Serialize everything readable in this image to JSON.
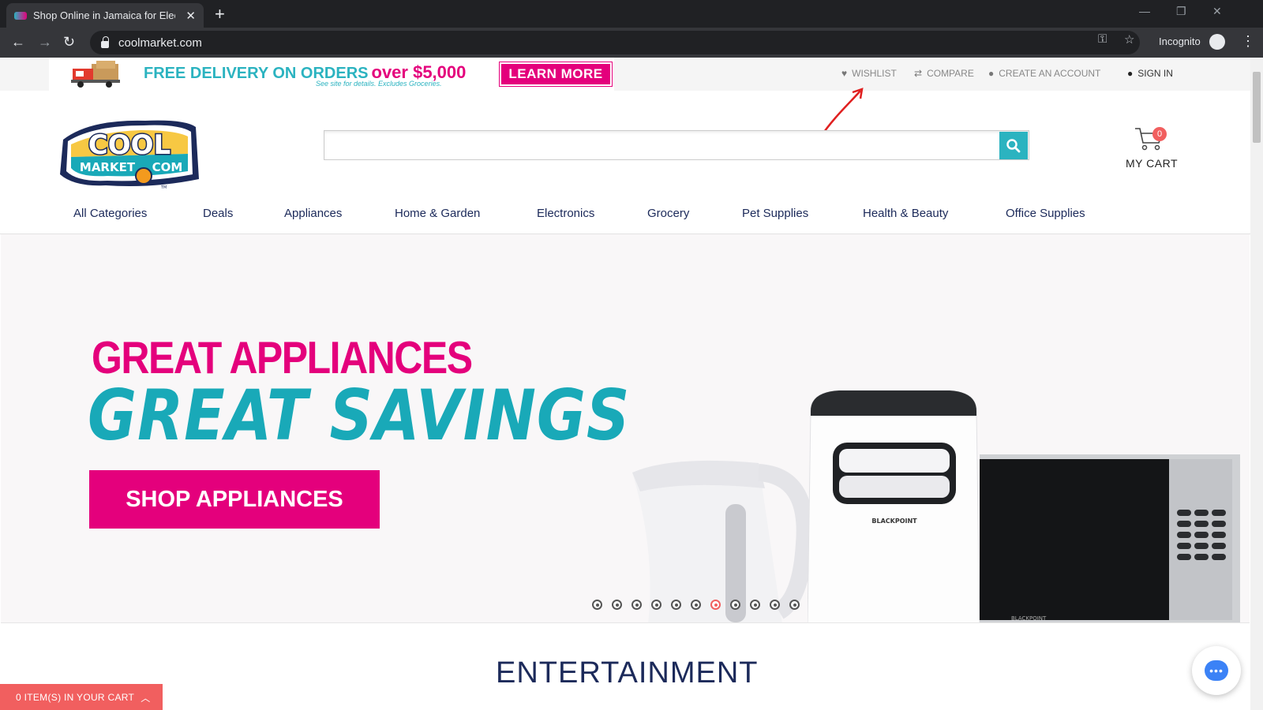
{
  "browser": {
    "tab_title": "Shop Online in Jamaica for Electr",
    "tab_close": "✕",
    "new_tab": "+",
    "url": "coolmarket.com",
    "incognito_label": "Incognito",
    "window_controls": [
      "—",
      "❐",
      "✕"
    ]
  },
  "promo": {
    "headline": "FREE DELIVERY ON ORDERS",
    "amount": "over $5,000",
    "subtext": "See site for details. Excludes Groceries.",
    "button": "LEARN MORE"
  },
  "top_links": {
    "wishlist": "WISHLIST",
    "compare": "COMPARE",
    "create_account": "CREATE AN ACCOUNT",
    "sign_in": "SIGN IN"
  },
  "logo": {
    "line1": "COOL",
    "line2": "MARKET",
    "line3": "COM",
    "tm": "TM"
  },
  "search": {
    "value": "",
    "placeholder": ""
  },
  "cart": {
    "count": "0",
    "label": "MY CART"
  },
  "categories": [
    "All Categories",
    "Deals",
    "Appliances",
    "Home & Garden",
    "Electronics",
    "Grocery",
    "Pet Supplies",
    "Health & Beauty",
    "Office Supplies"
  ],
  "hero": {
    "line1": "GREAT APPLIANCES",
    "line2": "GREAT SAVINGS",
    "button": "SHOP APPLIANCES",
    "brand": "BLACKPOINT",
    "brand2": "BLACKPOINT",
    "slide_count": 11,
    "active_slide": 7
  },
  "section_title": "ENTERTAINMENT",
  "cart_bar": {
    "label": "0 ITEM(S) IN YOUR CART"
  },
  "colors": {
    "brand_pink": "#e4007c",
    "brand_teal": "#2bb3c0",
    "cart_red": "#f15f5f",
    "nav_text": "#1c2a5a"
  },
  "icons": [
    "back-icon",
    "forward-icon",
    "reload-icon",
    "lock-icon",
    "key-icon",
    "star-icon",
    "incognito-icon",
    "heart-icon",
    "compare-icon",
    "user-icon",
    "search-icon",
    "cart-icon",
    "chat-icon"
  ]
}
